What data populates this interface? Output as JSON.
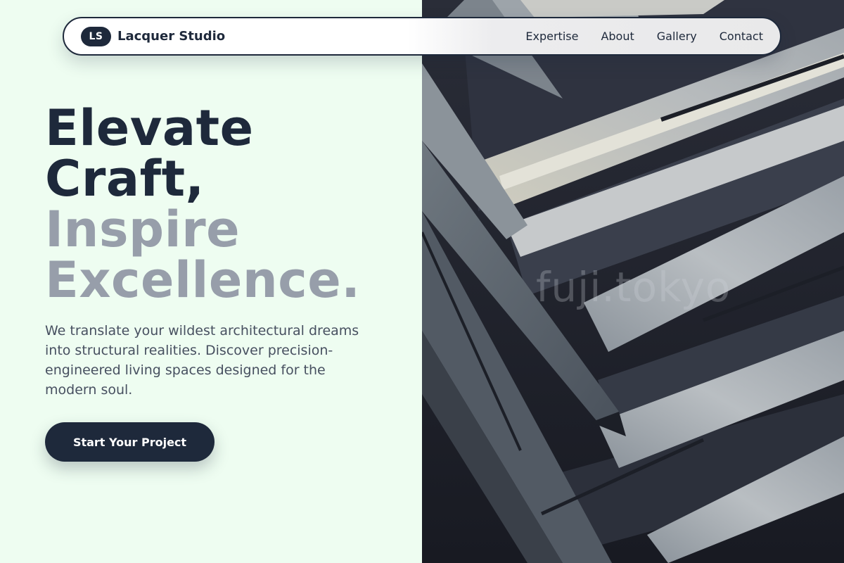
{
  "brand": {
    "badge": "LS",
    "name": "Lacquer Studio"
  },
  "nav": {
    "items": [
      {
        "label": "Expertise"
      },
      {
        "label": "About"
      },
      {
        "label": "Gallery"
      },
      {
        "label": "Contact"
      }
    ]
  },
  "hero": {
    "title_lines": [
      "Elevate",
      "Craft,",
      "Inspire",
      "Excellence."
    ],
    "description": "We translate your wildest architectural dreams into structural realities. Discover precision-engineered living spaces designed for the modern soul.",
    "cta_label": "Start Your Project"
  },
  "image": {
    "watermark": "fuji.tokyo"
  },
  "colors": {
    "background": "#eefdf1",
    "primary": "#1e293b",
    "muted_heading": "#979eaa",
    "body_text": "#475060"
  }
}
